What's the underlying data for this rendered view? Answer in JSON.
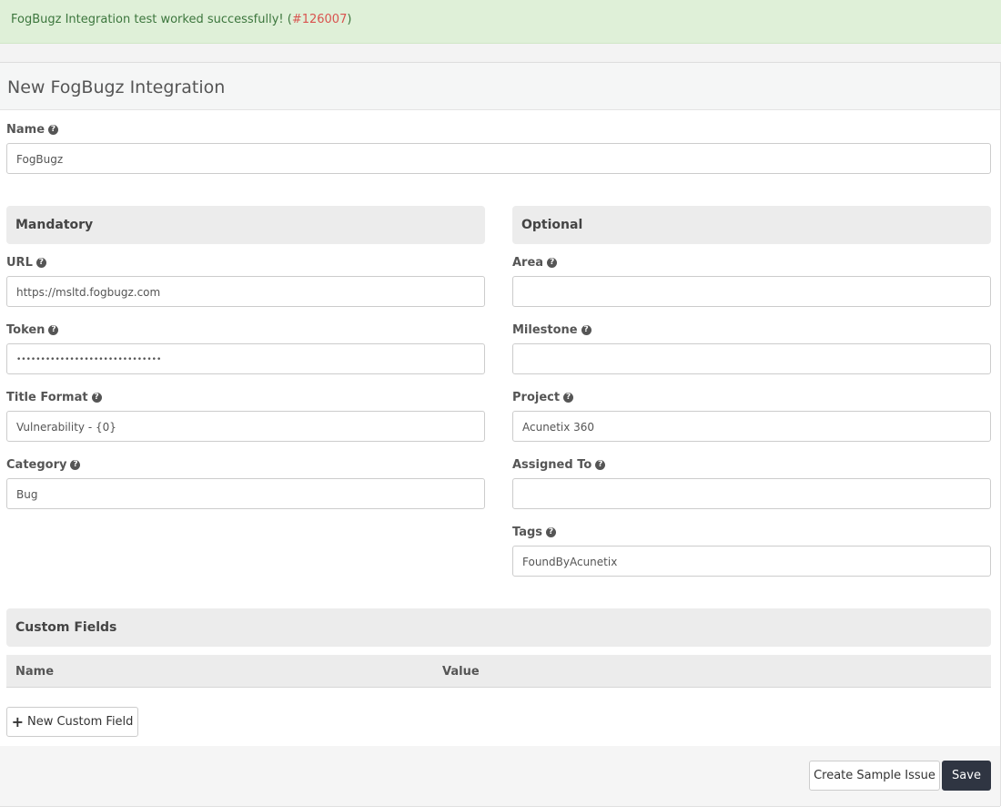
{
  "alert": {
    "message": "FogBugz Integration test worked successfully! (",
    "ref": "#126007",
    "close": ")"
  },
  "panel": {
    "title": "New FogBugz Integration"
  },
  "fields": {
    "name": {
      "label": "Name",
      "value": "FogBugz"
    },
    "url": {
      "label": "URL",
      "value": "https://msltd.fogbugz.com"
    },
    "token": {
      "label": "Token",
      "value": "••••••••••••••••••••••••••••••"
    },
    "title_format": {
      "label": "Title Format",
      "value": "Vulnerability - {0}"
    },
    "category": {
      "label": "Category",
      "value": "Bug"
    },
    "area": {
      "label": "Area",
      "value": ""
    },
    "milestone": {
      "label": "Milestone",
      "value": ""
    },
    "project": {
      "label": "Project",
      "value": "Acunetix 360"
    },
    "assigned_to": {
      "label": "Assigned To",
      "value": ""
    },
    "tags": {
      "label": "Tags",
      "value": "FoundByAcunetix"
    }
  },
  "sections": {
    "mandatory": "Mandatory",
    "optional": "Optional",
    "custom_fields": "Custom Fields"
  },
  "custom_table": {
    "columns": [
      "Name",
      "Value"
    ]
  },
  "buttons": {
    "new_custom_field": "New Custom Field",
    "new_custom_field_icon": "+",
    "create_sample_issue": "Create Sample Issue",
    "save": "Save"
  },
  "help_glyph": "?"
}
